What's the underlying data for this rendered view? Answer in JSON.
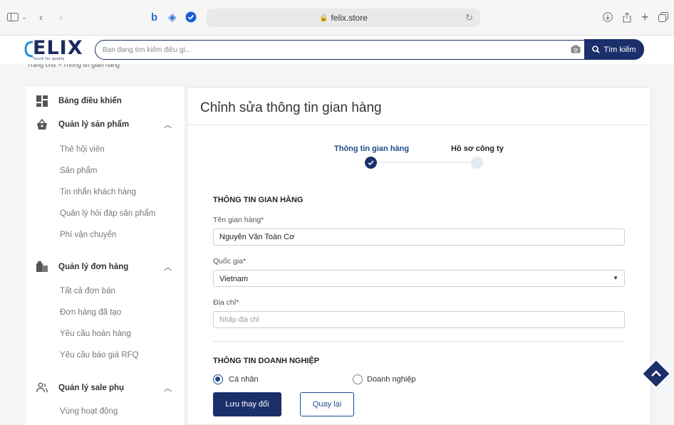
{
  "browser": {
    "url": "felix.store"
  },
  "header": {
    "logo_text": "ELIX",
    "logo_tagline": "Touch for quality",
    "search_placeholder": "Bạn đang tìm kiếm điều gì...",
    "search_button": "Tìm kiếm",
    "breadcrumb": "Trang chủ > Thông tin gian hàng"
  },
  "sidebar": {
    "dashboard": "Bảng điều khiển",
    "products_group": {
      "label": "Quản lý sản phẩm",
      "items": [
        "Thẻ hội viên",
        "Sản phẩm",
        "Tin nhắn khách hàng",
        "Quản lý hỏi đáp sản phẩm",
        "Phí vận chuyển"
      ]
    },
    "orders_group": {
      "label": "Quản lý đơn hàng",
      "items": [
        "Tất cả đơn bán",
        "Đơn hàng đã tạo",
        "Yêu cầu hoàn hàng",
        "Yêu cầu báo giá RFQ"
      ]
    },
    "sales_group": {
      "label": "Quản lý sale phụ",
      "items": [
        "Vùng hoạt động"
      ]
    }
  },
  "main": {
    "title": "Chỉnh sửa thông tin gian hàng",
    "steps": [
      "Thông tin gian hàng",
      "Hồ sơ công ty"
    ],
    "section_store": "THÔNG TIN GIAN HÀNG",
    "store_name_label": "Tên gian hàng*",
    "store_name_value": "Nguyễn Văn Toàn Cơ",
    "country_label": "Quốc gia*",
    "country_value": "Vietnam",
    "address_label": "Địa chỉ*",
    "address_placeholder": "Nhập địa chỉ",
    "section_business": "THÔNG TIN DOANH NGHIỆP",
    "radio_individual": "Cá nhân",
    "radio_business": "Doanh nghiệp",
    "save_button": "Lưu thay đổi",
    "back_button": "Quay lại"
  },
  "colors": {
    "brand_navy": "#1b2f6a",
    "step_active": "#1b4b8a"
  }
}
